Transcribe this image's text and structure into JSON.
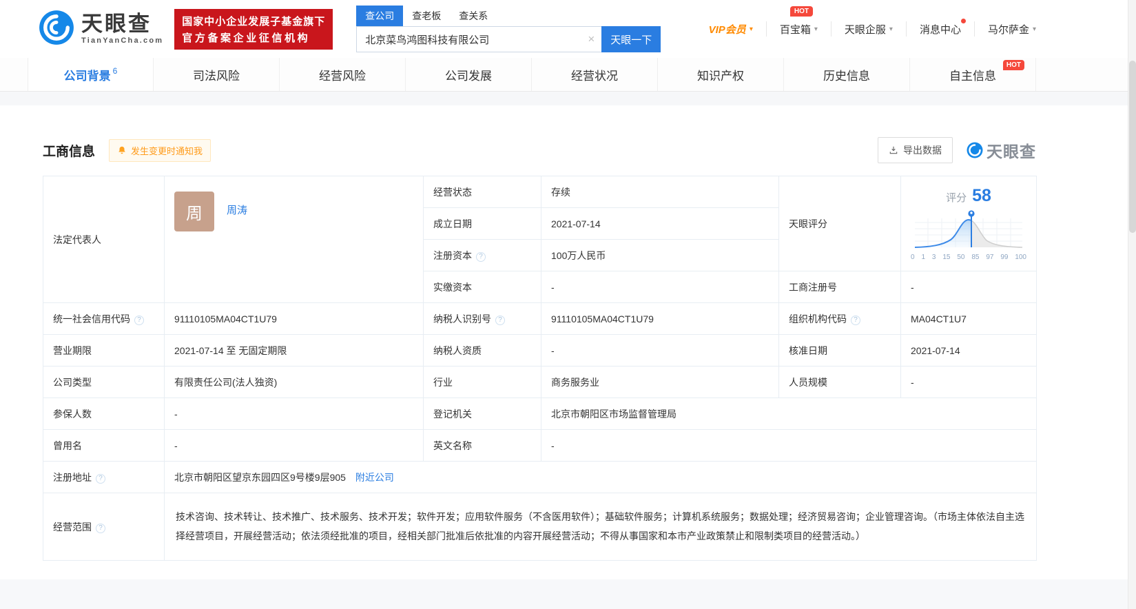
{
  "header": {
    "brand": "天眼查",
    "brand_domain": "TianYanCha.com",
    "gov_badge_line1": "国家中小企业发展子基金旗下",
    "gov_badge_line2": "官方备案企业征信机构",
    "search": {
      "tabs": [
        "查公司",
        "查老板",
        "查关系"
      ],
      "value": "北京菜鸟鸿图科技有限公司",
      "clear": "×",
      "button": "天眼一下"
    },
    "nav": {
      "vip": "VIP会员",
      "toolbox": "百宝箱",
      "services": "天眼企服",
      "messages": "消息中心",
      "user": "马尔萨金",
      "hot": "HOT"
    }
  },
  "tabs": {
    "items": [
      {
        "label": "公司背景",
        "count": "6"
      },
      {
        "label": "司法风险"
      },
      {
        "label": "经营风险"
      },
      {
        "label": "公司发展"
      },
      {
        "label": "经营状况"
      },
      {
        "label": "知识产权"
      },
      {
        "label": "历史信息"
      },
      {
        "label": "自主信息",
        "hot": "HOT"
      }
    ]
  },
  "section": {
    "title": "工商信息",
    "notify_button": "发生变更时通知我",
    "export_button": "导出数据",
    "watermark": "天眼查"
  },
  "score": {
    "label": "天眼评分",
    "score_label": "评分",
    "value": "58",
    "axis": [
      "0",
      "1",
      "3",
      "15",
      "50",
      "85",
      "97",
      "99",
      "100"
    ]
  },
  "icons": {
    "question": "?",
    "caret": "▾"
  },
  "fields": {
    "legal_rep": {
      "label": "法定代表人",
      "avatar": "周",
      "name": "周涛"
    },
    "status": {
      "label": "经营状态",
      "value": "存续"
    },
    "est_date": {
      "label": "成立日期",
      "value": "2021-07-14"
    },
    "reg_capital": {
      "label": "注册资本",
      "value": "100万人民币"
    },
    "paid_capital": {
      "label": "实缴资本",
      "value": "-"
    },
    "reg_number": {
      "label": "工商注册号",
      "value": "-"
    },
    "credit_code": {
      "label": "统一社会信用代码",
      "value": "91110105MA04CT1U79"
    },
    "taxpayer_id": {
      "label": "纳税人识别号",
      "value": "91110105MA04CT1U79"
    },
    "org_code": {
      "label": "组织机构代码",
      "value": "MA04CT1U7"
    },
    "business_term": {
      "label": "营业期限",
      "value": "2021-07-14 至 无固定期限"
    },
    "taxpayer_quality": {
      "label": "纳税人资质",
      "value": "-"
    },
    "approval_date": {
      "label": "核准日期",
      "value": "2021-07-14"
    },
    "company_type": {
      "label": "公司类型",
      "value": "有限责任公司(法人独资)"
    },
    "industry": {
      "label": "行业",
      "value": "商务服务业"
    },
    "staff_size": {
      "label": "人员规模",
      "value": "-"
    },
    "insured_count": {
      "label": "参保人数",
      "value": "-"
    },
    "registry": {
      "label": "登记机关",
      "value": "北京市朝阳区市场监督管理局"
    },
    "former_name": {
      "label": "曾用名",
      "value": "-"
    },
    "english_name": {
      "label": "英文名称",
      "value": "-"
    },
    "address": {
      "label": "注册地址",
      "value": "北京市朝阳区望京东园四区9号楼9层905",
      "link": "附近公司"
    },
    "scope": {
      "label": "经营范围",
      "value": "技术咨询、技术转让、技术推广、技术服务、技术开发；软件开发；应用软件服务（不含医用软件）；基础软件服务；计算机系统服务；数据处理；经济贸易咨询；企业管理咨询。（市场主体依法自主选择经营项目，开展经营活动；依法须经批准的项目，经相关部门批准后依批准的内容开展经营活动；不得从事国家和本市产业政策禁止和限制类项目的经营活动。）"
    }
  },
  "colors": {
    "accent_blue": "#2a7de1",
    "badge_red": "#c9161c",
    "hot_red": "#f5483b",
    "vip_orange": "#ff8a00",
    "label_bg": "#f2f7fc"
  }
}
